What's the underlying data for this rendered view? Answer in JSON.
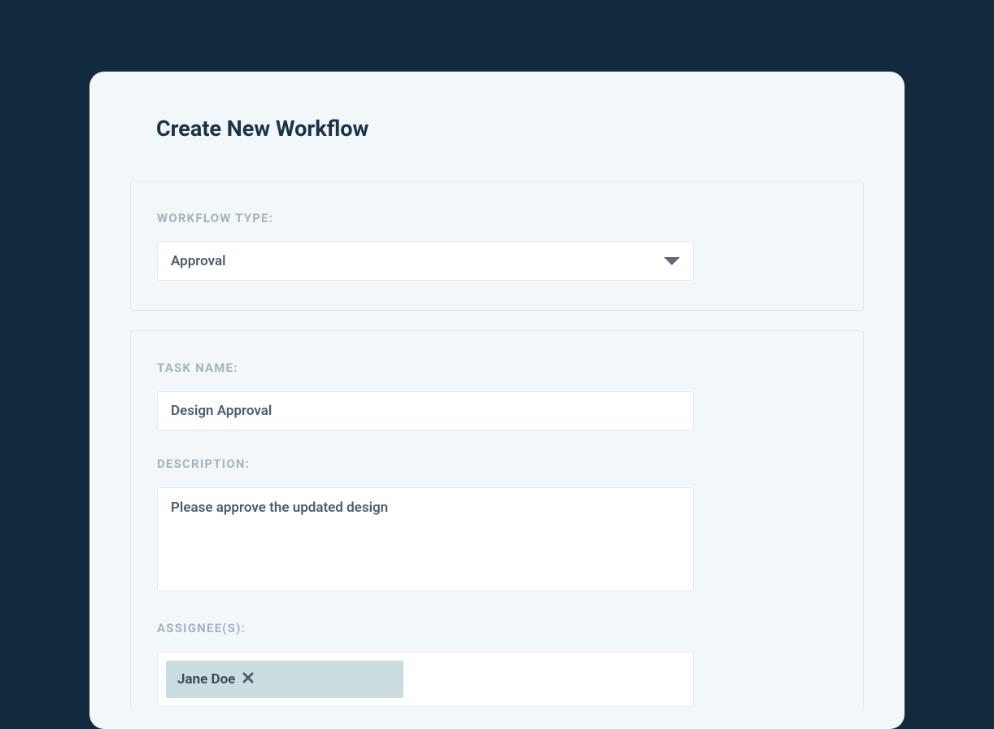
{
  "modal": {
    "title": "Create New Workflow"
  },
  "workflow_type": {
    "label": "WORKFLOW TYPE:",
    "selected": "Approval"
  },
  "task_name": {
    "label": "TASK NAME:",
    "value": "Design Approval"
  },
  "description": {
    "label": "DESCRIPTION:",
    "value": "Please approve the updated design"
  },
  "assignees": {
    "label": "ASSIGNEE(S):",
    "items": [
      {
        "name": "Jane Doe"
      }
    ]
  }
}
